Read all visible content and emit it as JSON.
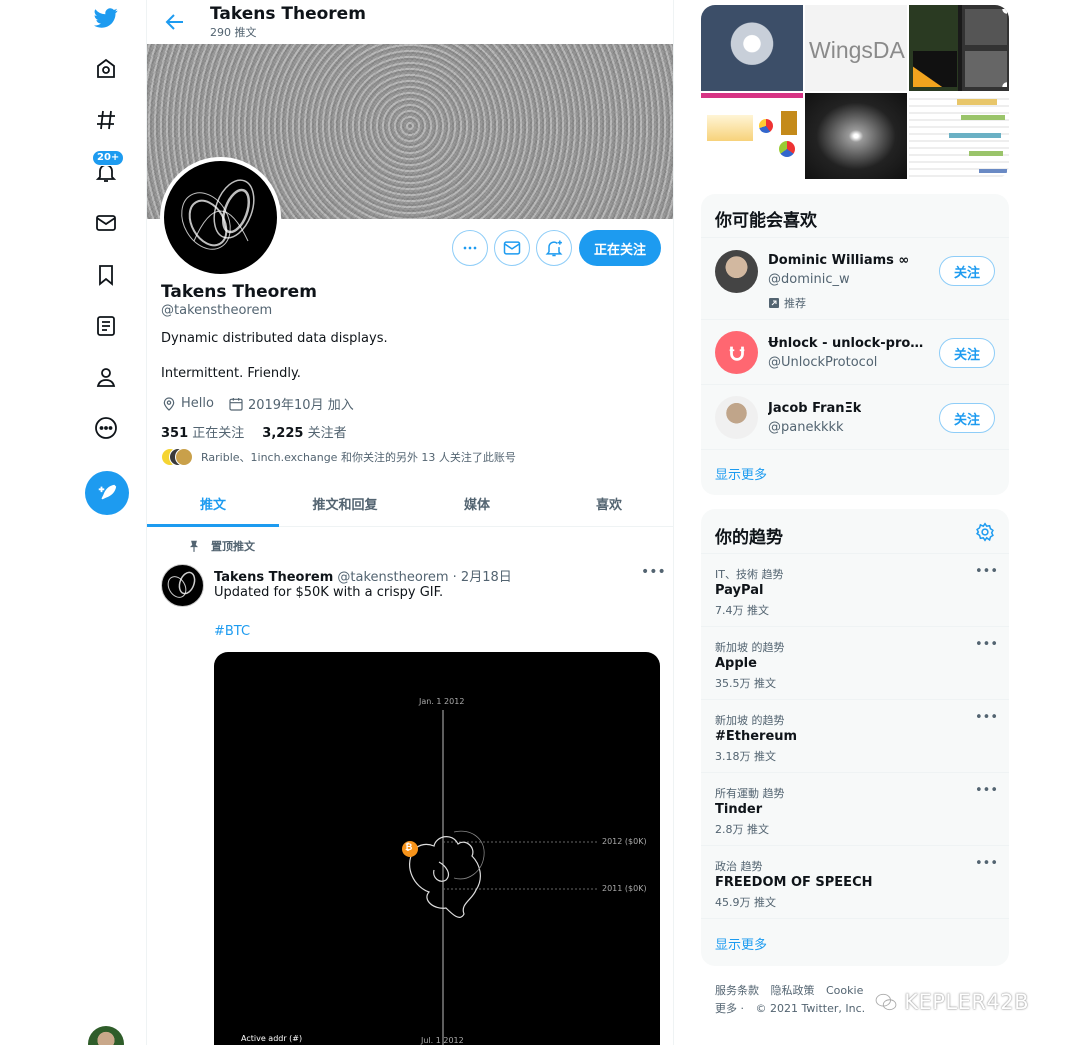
{
  "nav": {
    "icons": [
      "twitter-logo-icon",
      "home-icon",
      "explore-hashtag-icon",
      "notifications-bell-icon",
      "messages-envelope-icon",
      "bookmarks-icon",
      "lists-icon",
      "profile-icon",
      "more-icon",
      "compose-tweet-icon"
    ],
    "notification_badge": "20+"
  },
  "header": {
    "title": "Takens Theorem",
    "tweet_count": "290 推文"
  },
  "profile": {
    "name": "Takens Theorem",
    "handle": "@takenstheorem",
    "bio_line1": "Dynamic distributed data displays.",
    "bio_line2": "Intermittent. Friendly.",
    "location": "Hello",
    "joined": "2019年10月 加入",
    "following_count": "351",
    "following_label": "正在关注",
    "followers_count": "3,225",
    "followers_label": "关注者",
    "followed_by": "Rarible、1inch.exchange 和你关注的另外 13 人关注了此账号",
    "following_button": "正在关注"
  },
  "tabs": [
    "推文",
    "推文和回复",
    "媒体",
    "喜欢"
  ],
  "pinned_tweet": {
    "pinned_label": "置顶推文",
    "author": "Takens Theorem",
    "handle_date": "@takenstheorem · 2月18日",
    "text": "Updated for $50K with a crispy GIF.",
    "hashtag": "#BTC",
    "media_labels": {
      "top": "Jan. 1 2012",
      "bottom": "Jul. 1 2012",
      "line1": "2012 ($0K)",
      "line2": "2011 ($0K)",
      "corner": "Active addr (#)",
      "coin": "₿"
    }
  },
  "collage": {
    "wings_text": "WingsDA"
  },
  "who_to_follow": {
    "title": "你可能会喜欢",
    "users": [
      {
        "name": "Dominic Williams ∞",
        "handle": "@dominic_w",
        "note": "推荐",
        "button": "关注"
      },
      {
        "name": "Ʉnlock - unlock-protoc…",
        "handle": "@UnlockProtocol",
        "note": "",
        "button": "关注"
      },
      {
        "name": "Jacob FranΞk",
        "handle": "@panekkkk",
        "note": "",
        "button": "关注"
      }
    ],
    "show_more": "显示更多"
  },
  "trends": {
    "title": "你的趋势",
    "items": [
      {
        "context": "IT、技術 趋势",
        "name": "PayPal",
        "count": "7.4万 推文"
      },
      {
        "context": "新加坡 的趋势",
        "name": "Apple",
        "count": "35.5万 推文"
      },
      {
        "context": "新加坡 的趋势",
        "name": "#Ethereum",
        "count": "3.18万 推文"
      },
      {
        "context": "所有運動 趋势",
        "name": "Tinder",
        "count": "2.8万 推文"
      },
      {
        "context": "政治 趋势",
        "name": "FREEDOM OF SPEECH",
        "count": "45.9万 推文"
      }
    ],
    "show_more": "显示更多"
  },
  "footer": {
    "links": [
      "服务条款",
      "隐私政策",
      "Cookie"
    ],
    "more": "更多 ·",
    "copyright": "© 2021 Twitter, Inc."
  },
  "watermark": "KEPLER42B",
  "colors": {
    "accent": "#1d9bf0",
    "text_primary": "#0f1419",
    "text_secondary": "#536471",
    "panel_bg": "#f7f9f9",
    "coin": "#f7931a",
    "unlock_brand": "#ff6771"
  }
}
